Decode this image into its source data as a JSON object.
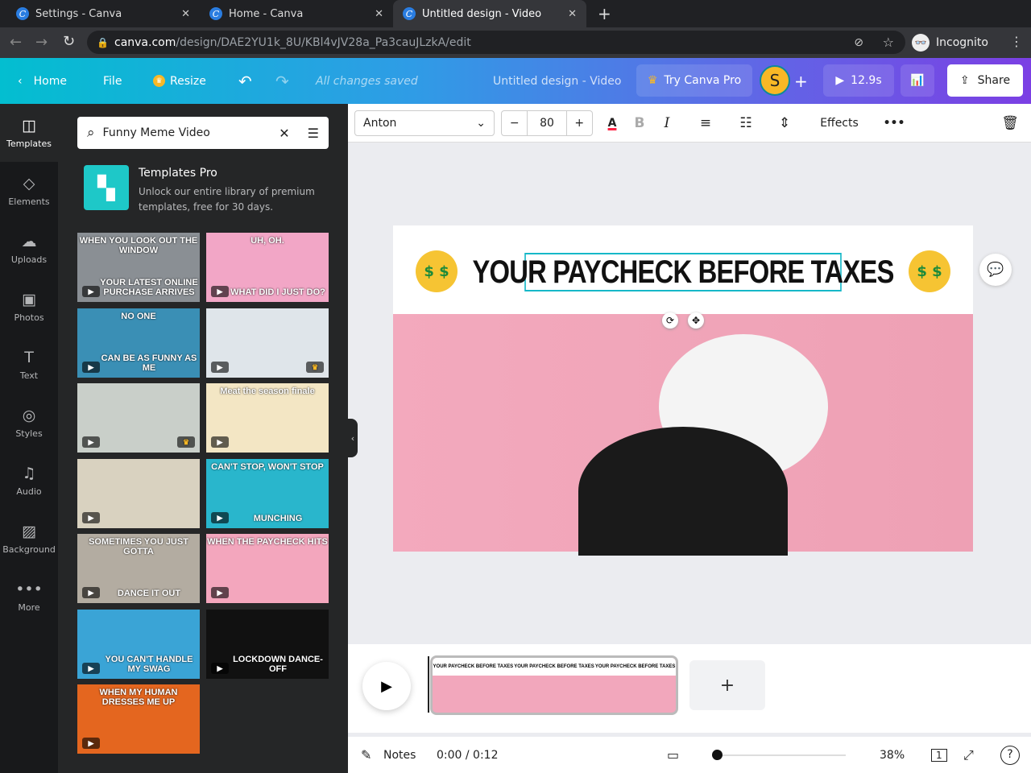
{
  "browser": {
    "tabs": [
      {
        "title": "Settings - Canva"
      },
      {
        "title": "Home - Canva"
      },
      {
        "title": "Untitled design - Video",
        "active": true
      }
    ],
    "url_domain": "canva.com",
    "url_path": "/design/DAE2YU1k_8U/KBl4vJV28a_Pa3cauJLzkA/edit",
    "profile": "Incognito"
  },
  "header": {
    "home": "Home",
    "file": "File",
    "resize": "Resize",
    "status": "All changes saved",
    "doc_title": "Untitled design - Video",
    "try_pro": "Try Canva Pro",
    "avatar": "S",
    "duration": "12.9s",
    "share": "Share"
  },
  "rail": [
    {
      "label": "Templates",
      "icon": "templates-icon"
    },
    {
      "label": "Elements",
      "icon": "elements-icon"
    },
    {
      "label": "Uploads",
      "icon": "upload-icon"
    },
    {
      "label": "Photos",
      "icon": "photos-icon"
    },
    {
      "label": "Text",
      "icon": "text-icon"
    },
    {
      "label": "Styles",
      "icon": "styles-icon"
    },
    {
      "label": "Audio",
      "icon": "audio-icon"
    },
    {
      "label": "Background",
      "icon": "background-icon"
    },
    {
      "label": "More",
      "icon": "more-icon"
    }
  ],
  "panel": {
    "search_value": "Funny Meme Video",
    "promo_title": "Templates Pro",
    "promo_text": "Unlock our entire library of premium templates, free for 30 days.",
    "thumbs": [
      {
        "top": "WHEN YOU LOOK OUT THE WINDOW",
        "bottom": "YOUR LATEST ONLINE PURCHASE ARRIVES",
        "bg": "#8a8f94"
      },
      {
        "top": "UH, OH.",
        "bottom": "WHAT DID I JUST DO?",
        "bg": "#f2a6c6"
      },
      {
        "top": "NO ONE",
        "bottom": "CAN BE AS FUNNY AS ME",
        "bg": "#3a8fb5"
      },
      {
        "top": "",
        "bottom": "",
        "bg": "#dfe5ea",
        "pro": true
      },
      {
        "top": "",
        "bottom": "",
        "bg": "#c9cfc9",
        "pro": true
      },
      {
        "top": "Meat the season finale",
        "bottom": "",
        "bg": "#f3e6c4"
      },
      {
        "top": "",
        "bottom": "",
        "bg": "#d9d2c0"
      },
      {
        "top": "CAN'T STOP, WON'T STOP",
        "bottom": "MUNCHING",
        "bg": "#29b6cc"
      },
      {
        "top": "SOMETIMES YOU JUST GOTTA",
        "bottom": "DANCE IT OUT",
        "bg": "#b3aca1"
      },
      {
        "top": "WHEN THE PAYCHECK HITS",
        "bottom": "",
        "bg": "#f3a6bd"
      },
      {
        "top": "",
        "bottom": "YOU CAN'T HANDLE MY SWAG",
        "bg": "#3aa4d6"
      },
      {
        "top": "",
        "bottom": "LOCKDOWN DANCE-OFF",
        "bg": "#111111"
      },
      {
        "top": "WHEN MY HUMAN DRESSES ME UP",
        "bottom": "",
        "bg": "#e4661f"
      }
    ]
  },
  "toolbar": {
    "font": "Anton",
    "size": "80",
    "effects": "Effects"
  },
  "canvas": {
    "headline": "YOUR PAYCHECK BEFORE TAXES",
    "emoji": "$ $"
  },
  "timeline": {
    "clip_caption": "YOUR PAYCHECK BEFORE TAXES"
  },
  "footer": {
    "notes": "Notes",
    "time": "0:00 / 0:12",
    "zoom": "38%",
    "zoom_fraction": 0.38,
    "page": "1"
  },
  "colors": {
    "accent": "#00c4cc",
    "brand_purple": "#7d2ae8",
    "selection": "#16b8c8"
  }
}
